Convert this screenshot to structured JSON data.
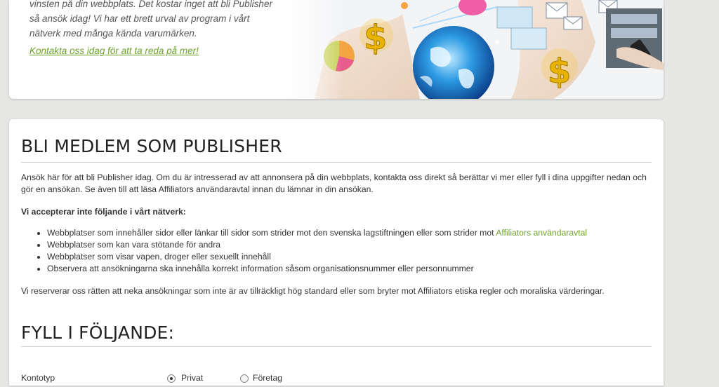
{
  "hero": {
    "line1": "vinsten på din webbplats. Det kostar inget att bli Publisher",
    "line2": "så ansök idag! Vi har ett brett urval av program i vårt",
    "line3": "nätverk med många kända varumärken.",
    "link": "Kontakta oss idag för att ta reda på mer!",
    "dollar_glyph": "$"
  },
  "publisher": {
    "heading": "BLI MEDLEM SOM PUBLISHER",
    "intro": "Ansök här för att bli Publisher idag. Om du är intresserad av att annonsera på din webbplats, kontakta oss direkt så berättar vi mer eller fyll i dina uppgifter nedan och gör en ansökan. Se även till att läsa Affiliators användaravtal innan du lämnar in din ansökan.",
    "not_accepted_label": "Vi accepterar inte följande i vårt nätverk:",
    "rules": [
      {
        "text": "Webbplatser som innehåller sidor eller länkar till sidor som strider mot den svenska lagstiftningen eller som strider mot ",
        "link": "Affiliators användaravtal"
      },
      {
        "text": "Webbplatser som kan vara stötande för andra",
        "link": ""
      },
      {
        "text": "Webbplatser som visar vapen, droger eller sexuellt innehåll",
        "link": ""
      },
      {
        "text": "Observera att ansökningarna ska innehålla korrekt information såsom organisationsnummer eller personnummer",
        "link": ""
      }
    ],
    "reservation": "Vi reserverar oss rätten att neka ansökningar som inte är av tillräckligt hög standard eller som bryter mot Affiliators etiska regler och moraliska värderingar."
  },
  "form": {
    "heading": "FYLL I FÖLJANDE:",
    "type_label": "Kontotyp",
    "option_private": "Privat",
    "option_company": "Företag",
    "selected": "private"
  },
  "colors": {
    "accent_green": "#6ea42a",
    "background": "#e6e6e4",
    "card": "#ffffff"
  }
}
